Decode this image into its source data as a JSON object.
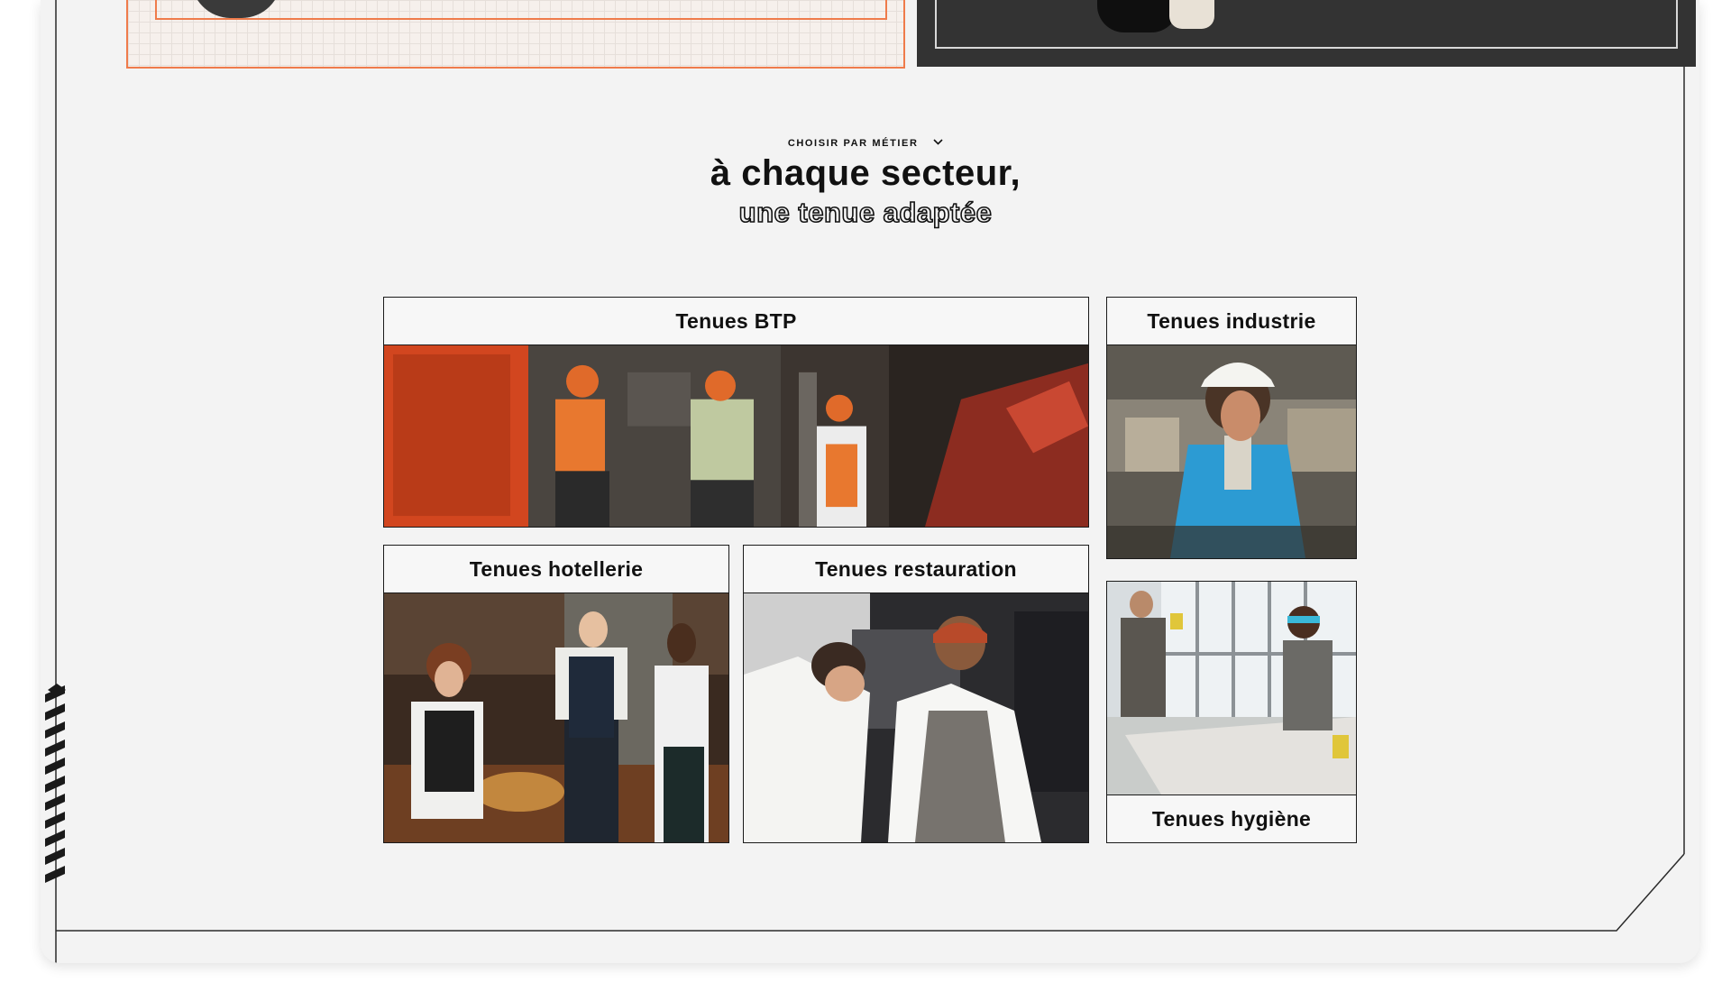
{
  "section": {
    "eyebrow": "CHOISIR PAR MÉTIER",
    "title": "à chaque secteur,",
    "subtitle": "une tenue adaptée"
  },
  "tiles": [
    {
      "label": "Tenues BTP",
      "image": "construction-workers-photo"
    },
    {
      "label": "Tenues industrie",
      "image": "industry-worker-photo"
    },
    {
      "label": "Tenues hotellerie",
      "image": "hotel-staff-photo"
    },
    {
      "label": "Tenues restauration",
      "image": "chefs-kitchen-photo"
    },
    {
      "label": "Tenues hygiène",
      "image": "cleaning-staff-photo"
    }
  ],
  "colors": {
    "accent": "#ef7b4b",
    "background": "#f3f3f3",
    "ink": "#111111"
  }
}
